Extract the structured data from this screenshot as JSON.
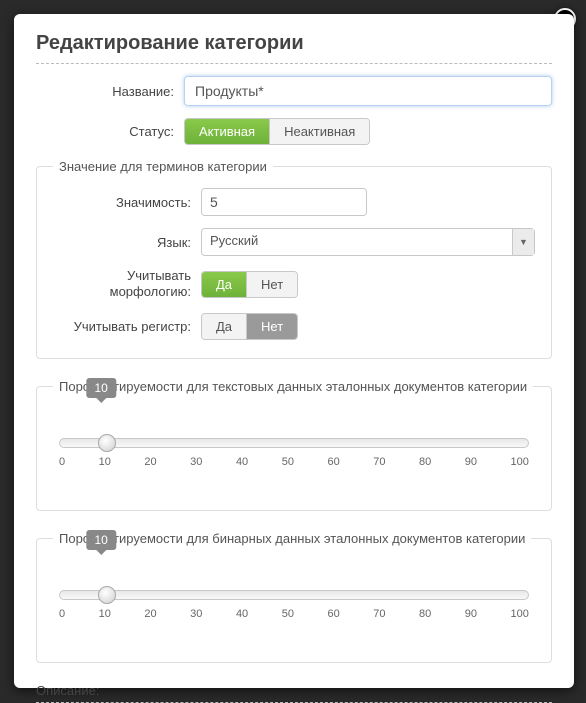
{
  "bg_hint": "",
  "modal": {
    "title": "Редактирование категории",
    "close_label": "x",
    "name_label": "Название:",
    "name_value": "Продукты*",
    "status_label": "Статус:",
    "status_active": "Активная",
    "status_inactive": "Неактивная",
    "terms_section": {
      "legend": "Значение для терминов категории",
      "significance_label": "Значимость:",
      "significance_value": "5",
      "language_label": "Язык:",
      "language_value": "Русский",
      "morph_label_l1": "Учитывать",
      "morph_label_l2": "морфологию:",
      "yes": "Да",
      "no": "Нет",
      "case_label": "Учитывать регистр:"
    },
    "slider1": {
      "legend": "Порог цитируемости для текстовых данных эталонных документов категории",
      "value": "10",
      "ticks": [
        "0",
        "10",
        "20",
        "30",
        "40",
        "50",
        "60",
        "70",
        "80",
        "90",
        "100"
      ]
    },
    "slider2": {
      "legend": "Порог цитируемости для бинарных данных эталонных документов категории",
      "value": "10",
      "ticks": [
        "0",
        "10",
        "20",
        "30",
        "40",
        "50",
        "60",
        "70",
        "80",
        "90",
        "100"
      ]
    },
    "description_label": "Описание:"
  }
}
